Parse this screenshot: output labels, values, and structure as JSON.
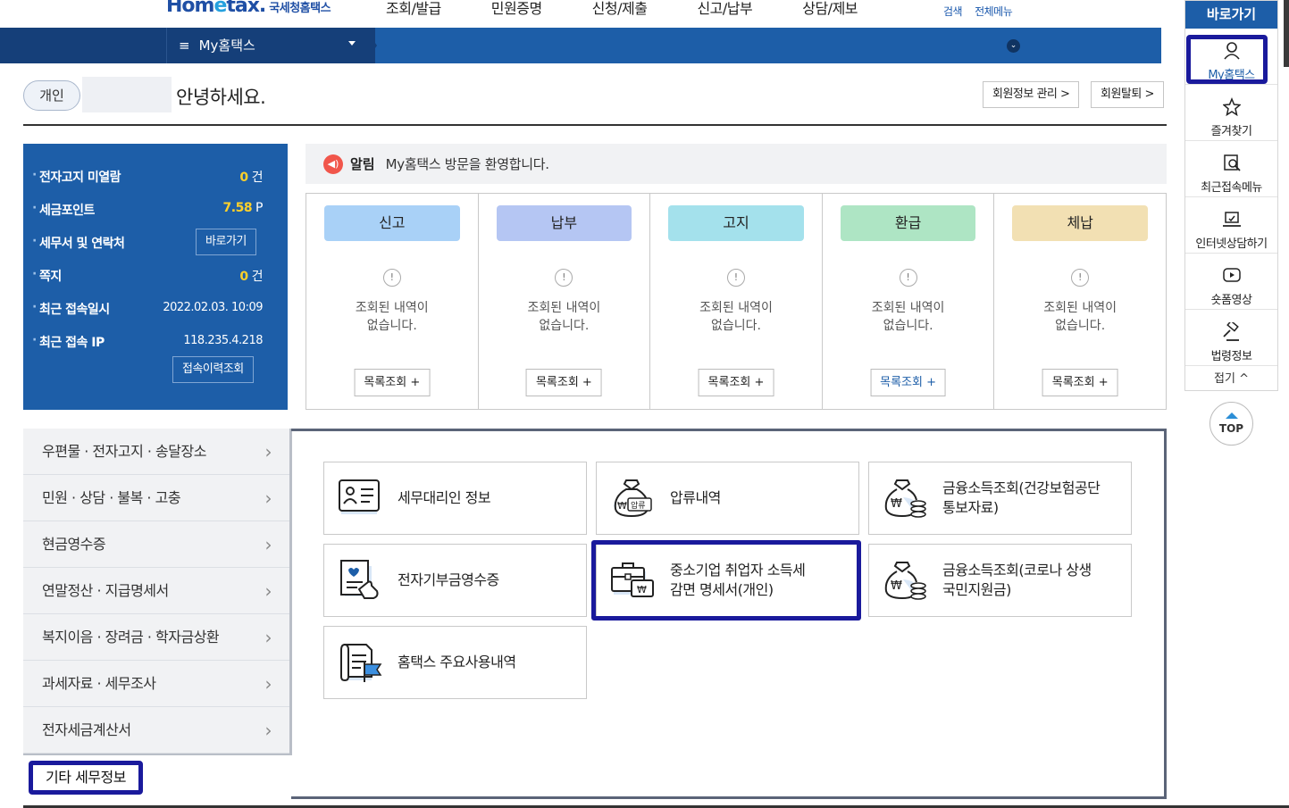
{
  "header": {
    "logo_en": "Hom",
    "logo_e": "e",
    "logo_en2": "tax.",
    "logo_ko": "국세청홈택스",
    "gnb": [
      "조회/발급",
      "민원증명",
      "신청/제출",
      "신고/납부",
      "상담/제보"
    ],
    "util": [
      "검색",
      "전체메뉴"
    ]
  },
  "nav": {
    "menu_label": "My홈택스"
  },
  "greeting": {
    "badge": "개인",
    "text": "안녕하세요.",
    "btn_member": "회원정보 관리 >",
    "btn_withdraw": "회원탈퇴 >"
  },
  "info": {
    "rows": [
      {
        "label": "전자고지 미열람",
        "value": "0",
        "unit": "건"
      },
      {
        "label": "세금포인트",
        "value": "7.58",
        "unit": "P"
      },
      {
        "label": "세무서 및 연락처",
        "button": "바로가기"
      },
      {
        "label": "쪽지",
        "value": "0",
        "unit": "건"
      },
      {
        "label": "최근 접속일시",
        "text": "2022.02.03.  10:09"
      },
      {
        "label": "최근 접속 IP",
        "text": "118.235.4.218"
      }
    ],
    "history_button": "접속이력조회"
  },
  "notice": {
    "icon": "megaphone-icon",
    "label": "알림",
    "text": "My홈택스 방문을 환영합니다."
  },
  "status_cards": [
    {
      "title": "신고",
      "color": "#a9d1f7",
      "empty": [
        "조회된 내역이",
        "없습니다."
      ],
      "button": "목록조회 +"
    },
    {
      "title": "납부",
      "color": "#b5c6f3",
      "empty": [
        "조회된 내역이",
        "없습니다."
      ],
      "button": "목록조회 +"
    },
    {
      "title": "고지",
      "color": "#a4e1ec",
      "empty": [
        "조회된 내역이",
        "없습니다."
      ],
      "button": "목록조회 +"
    },
    {
      "title": "환급",
      "color": "#aee5c4",
      "empty": [
        "조회된 내역이",
        "없습니다."
      ],
      "button": "목록조회 +"
    },
    {
      "title": "체납",
      "color": "#f2e0b3",
      "empty": [
        "조회된 내역이",
        "없습니다."
      ],
      "button": "목록조회 +"
    }
  ],
  "left_menu": [
    "우편물 · 전자고지 · 송달장소",
    "민원 · 상담 · 불복 · 고충",
    "현금영수증",
    "연말정산 · 지급명세서",
    "복지이음 · 장려금 · 학자금상환",
    "과세자료 · 세무조사",
    "전자세금계산서"
  ],
  "etc_label": "기타 세무정보",
  "tiles": [
    {
      "name": "tax-agent-info-tile",
      "icon": "id-card-icon",
      "lines": [
        "세무대리인 정보"
      ]
    },
    {
      "name": "seizure-tile",
      "icon": "money-bag-seizure-icon",
      "lines": [
        "압류내역"
      ]
    },
    {
      "name": "financial-income-health-tile",
      "icon": "money-bag-coins-icon",
      "lines": [
        "금융소득조회(건강보험공단",
        "통보자료)"
      ]
    },
    {
      "name": "donation-receipt-tile",
      "icon": "document-hand-icon",
      "lines": [
        "전자기부금영수증"
      ]
    },
    {
      "name": "sme-tax-reduction-tile",
      "icon": "briefcase-won-icon",
      "lines": [
        "중소기업 취업자 소득세",
        "감면 명세서(개인)"
      ]
    },
    {
      "name": "financial-income-covid-tile",
      "icon": "money-bag-coins-icon",
      "lines": [
        "금융소득조회(코로나 상생",
        "국민지원금)"
      ]
    },
    {
      "name": "hometax-usage-tile",
      "icon": "document-flag-icon",
      "lines": [
        "홈택스 주요사용내역"
      ]
    }
  ],
  "quick": {
    "title": "바로가기",
    "items": [
      {
        "icon": "person-icon",
        "label": "My홈택스"
      },
      {
        "icon": "star-icon",
        "label": "즐겨찾기"
      },
      {
        "icon": "recent-search-icon",
        "label": "최근접속메뉴"
      },
      {
        "icon": "laptop-chat-icon",
        "label": "인터넷상담하기"
      },
      {
        "icon": "play-icon",
        "label": "숏폼영상"
      },
      {
        "icon": "gavel-icon",
        "label": "법령정보"
      }
    ],
    "fold": "접기 ^",
    "top": "TOP"
  }
}
